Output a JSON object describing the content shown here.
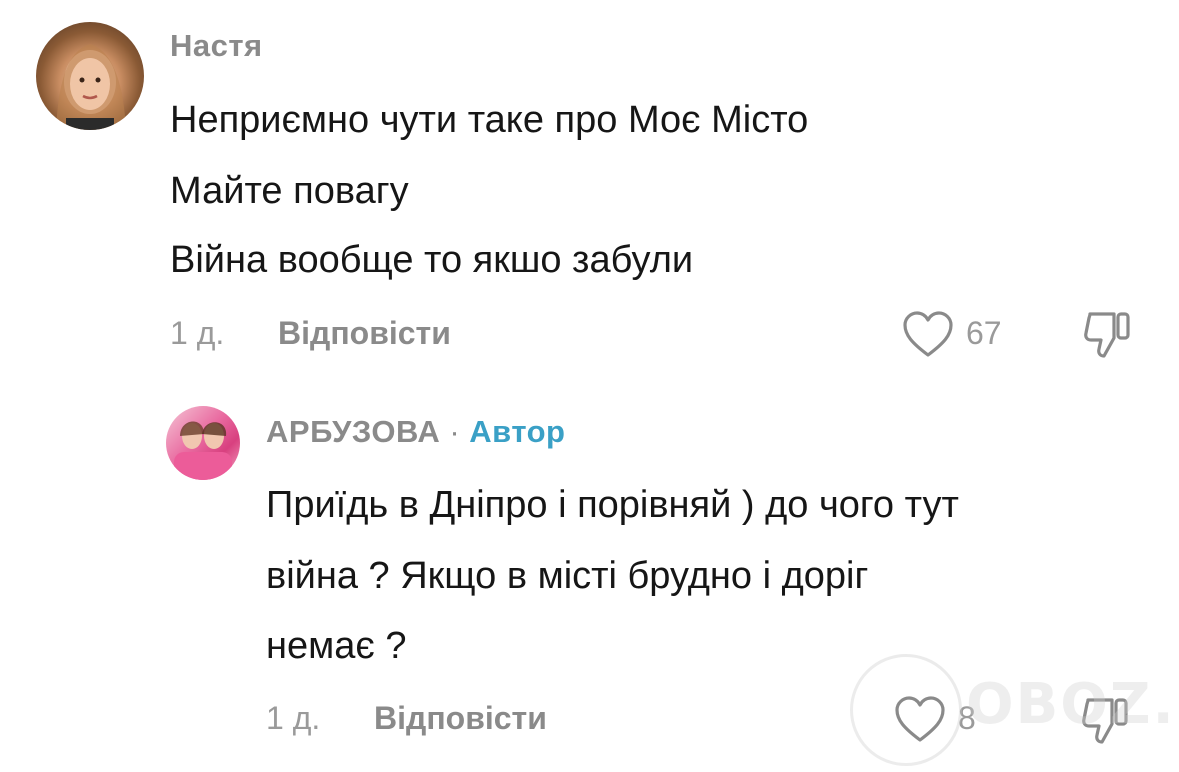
{
  "comments": [
    {
      "username": "Настя",
      "lines": [
        "Неприємно чути таке про Моє Місто",
        "Майте повагу",
        "Війна вообще то якшо забули"
      ],
      "time": "1 д.",
      "reply_label": "Відповісти",
      "likes": "67"
    },
    {
      "username": "АРБУЗОВА",
      "separator": "·",
      "author_label": "Автор",
      "lines": [
        "Приїдь в Дніпро і порівняй ) до чого тут",
        "війна ? Якщо в місті брудно і доріг",
        "немає ?"
      ],
      "time": "1 д.",
      "reply_label": "Відповісти",
      "likes": "8"
    }
  ],
  "icons": {
    "like": "heart-outline-icon",
    "dislike": "thumbs-down-outline-icon"
  },
  "colors": {
    "text": "#161616",
    "muted": "#8a8a8a",
    "author_tag": "#3aa0c6",
    "background": "#ffffff"
  },
  "watermark": {
    "text": "OBOZ.UA"
  }
}
